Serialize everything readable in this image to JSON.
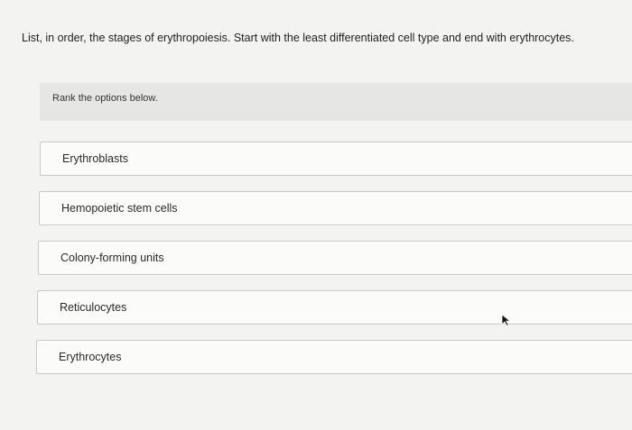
{
  "question": {
    "text": "List, in order, the stages of erythropoiesis. Start with the least differentiated cell type and end with erythrocytes."
  },
  "ranking": {
    "instruction": "Rank the options below.",
    "options": [
      "Erythroblasts",
      "Hemopoietic stem cells",
      "Colony-forming units",
      "Reticulocytes",
      "Erythrocytes"
    ]
  },
  "icons": {
    "cursor": "mouse-pointer-icon"
  }
}
